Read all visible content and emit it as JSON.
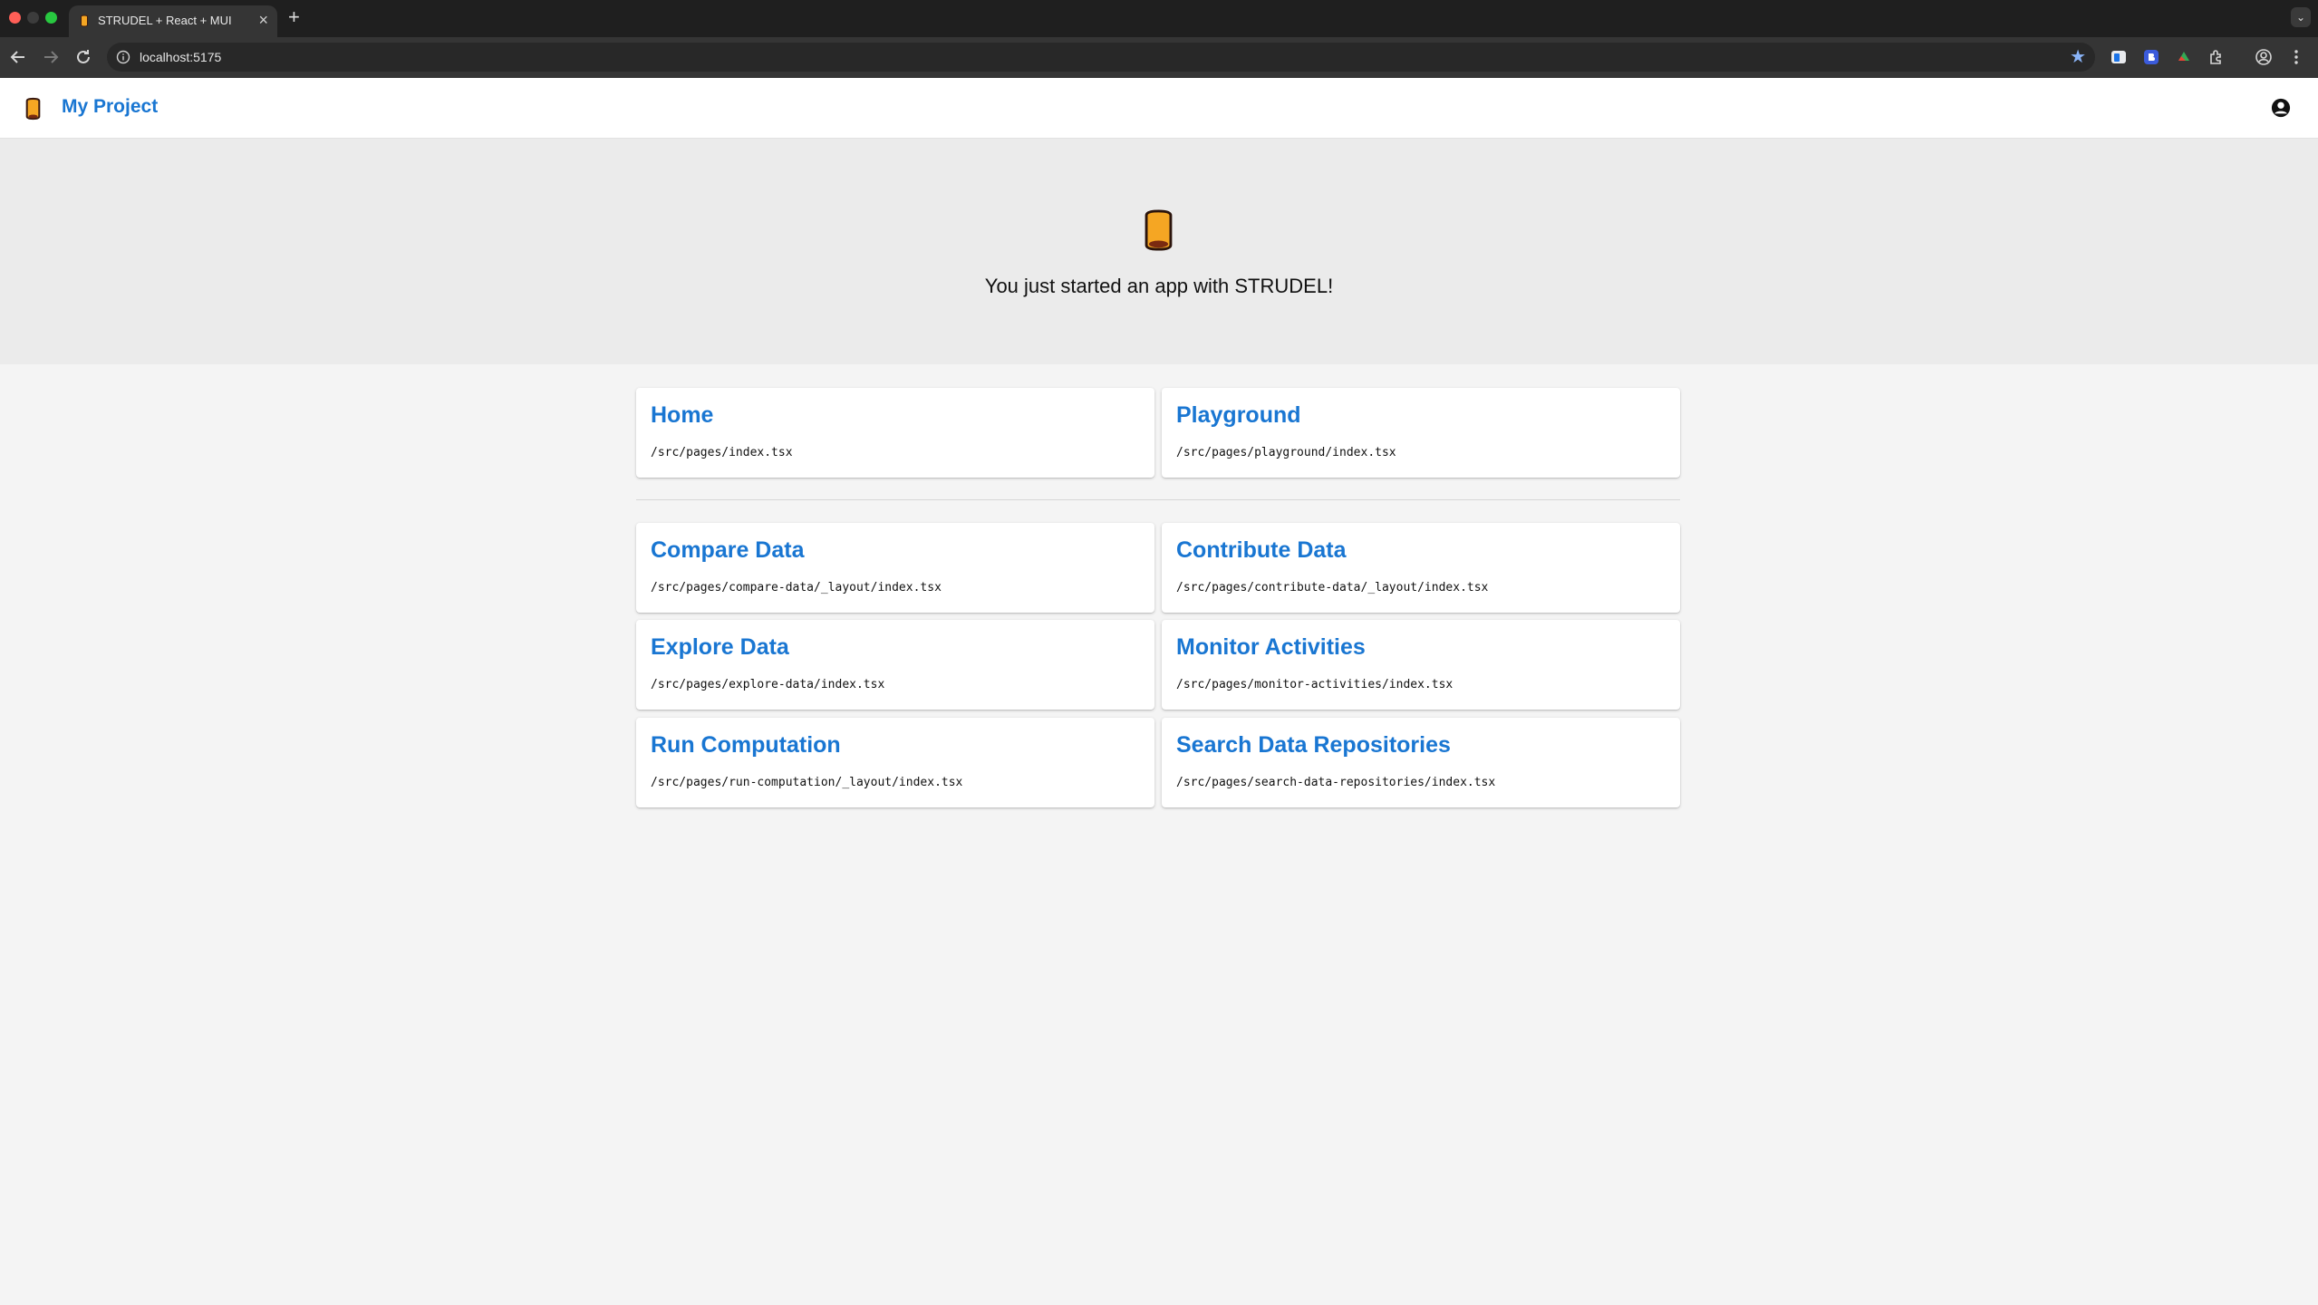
{
  "browser": {
    "tab_title": "STRUDEL + React + MUI",
    "tab_close": "×",
    "new_tab": "+",
    "tab_menu": "⌄",
    "url": "localhost:5175"
  },
  "app": {
    "title": "My Project",
    "hero_text": "You just started an app with STRUDEL!"
  },
  "pages_top": [
    {
      "title": "Home",
      "path": "/src/pages/index.tsx"
    },
    {
      "title": "Playground",
      "path": "/src/pages/playground/index.tsx"
    }
  ],
  "pages": [
    {
      "title": "Compare Data",
      "path": "/src/pages/compare-data/_layout/index.tsx"
    },
    {
      "title": "Contribute Data",
      "path": "/src/pages/contribute-data/_layout/index.tsx"
    },
    {
      "title": "Explore Data",
      "path": "/src/pages/explore-data/index.tsx"
    },
    {
      "title": "Monitor Activities",
      "path": "/src/pages/monitor-activities/index.tsx"
    },
    {
      "title": "Run Computation",
      "path": "/src/pages/run-computation/_layout/index.tsx"
    },
    {
      "title": "Search Data Repositories",
      "path": "/src/pages/search-data-repositories/index.tsx"
    }
  ],
  "colors": {
    "accent": "#1976d2",
    "logo_fill": "#f5a623",
    "logo_stroke": "#3a1a10"
  }
}
